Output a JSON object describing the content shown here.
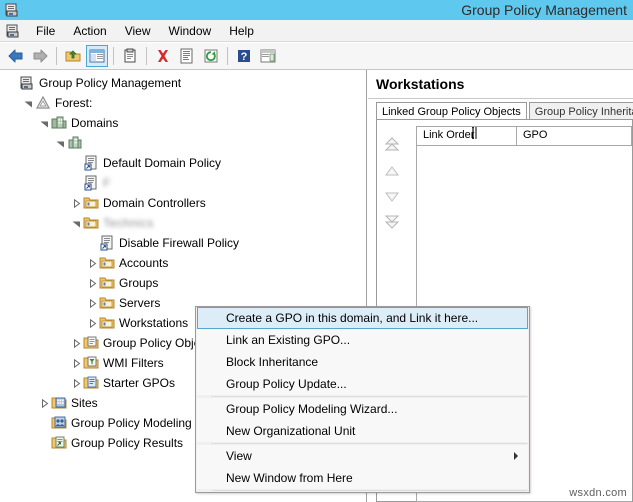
{
  "window": {
    "title": "Group Policy Management",
    "icon": "gpmc-console-icon"
  },
  "menubar": {
    "icon": "gpmc-console-icon",
    "items": [
      {
        "label": "File"
      },
      {
        "label": "Action"
      },
      {
        "label": "View"
      },
      {
        "label": "Window"
      },
      {
        "label": "Help"
      }
    ]
  },
  "toolbar": {
    "buttons": [
      {
        "name": "back-icon",
        "tooltip": "Back"
      },
      {
        "name": "forward-icon",
        "tooltip": "Forward"
      },
      {
        "name": "up-one-level-icon",
        "tooltip": "Up One Level"
      },
      {
        "name": "show-hide-console-tree-icon",
        "tooltip": "Show/Hide Console Tree",
        "pressed": true
      },
      {
        "name": "properties-icon",
        "tooltip": "Properties"
      },
      {
        "name": "delete-icon",
        "tooltip": "Delete"
      },
      {
        "name": "report-icon",
        "tooltip": "Report"
      },
      {
        "name": "refresh-icon",
        "tooltip": "Refresh"
      },
      {
        "name": "help-icon",
        "tooltip": "Help"
      },
      {
        "name": "show-hide-action-pane-icon",
        "tooltip": "Show/Hide Action Pane"
      }
    ]
  },
  "tree": {
    "nodes": [
      {
        "label": "Group Policy Management",
        "icon": "gpmc-console-icon",
        "indent": 0,
        "expander": "none",
        "redacted": ""
      },
      {
        "label": "Forest:",
        "icon": "forest-icon",
        "indent": 1,
        "expander": "expanded",
        "redacted": ""
      },
      {
        "label": "Domains",
        "icon": "domains-icon",
        "indent": 2,
        "expander": "expanded",
        "redacted": ""
      },
      {
        "label": "",
        "icon": "domain-icon",
        "indent": 3,
        "expander": "expanded",
        "redacted": ""
      },
      {
        "label": "Default Domain Policy",
        "icon": "gpo-link-icon",
        "indent": 4,
        "expander": "none",
        "redacted": ""
      },
      {
        "label": "",
        "icon": "gpo-link-icon",
        "indent": 4,
        "expander": "none",
        "redacted": "F"
      },
      {
        "label": "Domain Controllers",
        "icon": "ou-folder-icon",
        "indent": 4,
        "expander": "collapsed",
        "redacted": ""
      },
      {
        "label": "",
        "icon": "ou-folder-icon",
        "indent": 4,
        "expander": "expanded",
        "redacted": "Technics"
      },
      {
        "label": "Disable Firewall Policy",
        "icon": "gpo-link-icon",
        "indent": 5,
        "expander": "none",
        "redacted": ""
      },
      {
        "label": "Accounts",
        "icon": "ou-folder-icon",
        "indent": 5,
        "expander": "collapsed",
        "redacted": ""
      },
      {
        "label": "Groups",
        "icon": "ou-folder-icon",
        "indent": 5,
        "expander": "collapsed",
        "redacted": ""
      },
      {
        "label": "Servers",
        "icon": "ou-folder-icon",
        "indent": 5,
        "expander": "collapsed",
        "redacted": ""
      },
      {
        "label": "Workstations",
        "icon": "ou-folder-icon",
        "indent": 5,
        "expander": "collapsed",
        "redacted": "",
        "selected": true
      },
      {
        "label": "Group Policy Objects",
        "icon": "gpo-container-icon",
        "indent": 4,
        "expander": "collapsed",
        "redacted": ""
      },
      {
        "label": "WMI Filters",
        "icon": "wmi-filter-icon",
        "indent": 4,
        "expander": "collapsed",
        "redacted": ""
      },
      {
        "label": "Starter GPOs",
        "icon": "starter-gpo-icon",
        "indent": 4,
        "expander": "collapsed",
        "redacted": ""
      },
      {
        "label": "Sites",
        "icon": "sites-icon",
        "indent": 2,
        "expander": "collapsed",
        "redacted": ""
      },
      {
        "label": "Group Policy Modeling",
        "icon": "gp-modeling-icon",
        "indent": 2,
        "expander": "none",
        "redacted": ""
      },
      {
        "label": "Group Policy Results",
        "icon": "gp-results-icon",
        "indent": 2,
        "expander": "none",
        "redacted": ""
      }
    ]
  },
  "detail": {
    "header": "Workstations",
    "tabs": [
      {
        "label": "Linked Group Policy Objects",
        "active": true
      },
      {
        "label": "Group Policy Inherita",
        "active": false
      }
    ],
    "link_order_buttons": [
      {
        "name": "move-to-top-button"
      },
      {
        "name": "move-up-button"
      },
      {
        "name": "move-down-button"
      },
      {
        "name": "move-to-bottom-button"
      }
    ],
    "grid": {
      "columns": [
        "Link Order",
        "GPO"
      ],
      "rows": []
    }
  },
  "context_menu": {
    "items": [
      {
        "label": "Create a GPO in this domain, and Link it here...",
        "highlight": true,
        "submenu": false,
        "separator_after": false
      },
      {
        "label": "Link an Existing GPO...",
        "highlight": false,
        "submenu": false,
        "separator_after": false
      },
      {
        "label": "Block Inheritance",
        "highlight": false,
        "submenu": false,
        "separator_after": false
      },
      {
        "label": "Group Policy Update...",
        "highlight": false,
        "submenu": false,
        "separator_after": true
      },
      {
        "label": "Group Policy Modeling Wizard...",
        "highlight": false,
        "submenu": false,
        "separator_after": false
      },
      {
        "label": "New Organizational Unit",
        "highlight": false,
        "submenu": false,
        "separator_after": true
      },
      {
        "label": "View",
        "highlight": false,
        "submenu": true,
        "separator_after": false
      },
      {
        "label": "New Window from Here",
        "highlight": false,
        "submenu": false,
        "separator_after": true
      }
    ]
  },
  "watermark": {
    "text": "wsxdn.com"
  },
  "colors": {
    "titlebar": "#5ec8ee",
    "selection_fill": "#e6f1fb",
    "selection_border": "#7da2ce",
    "menu_highlight_fill": "#dcedf7",
    "menu_highlight_border": "#59a5d0",
    "folder_yellow": "#f2c76a"
  }
}
